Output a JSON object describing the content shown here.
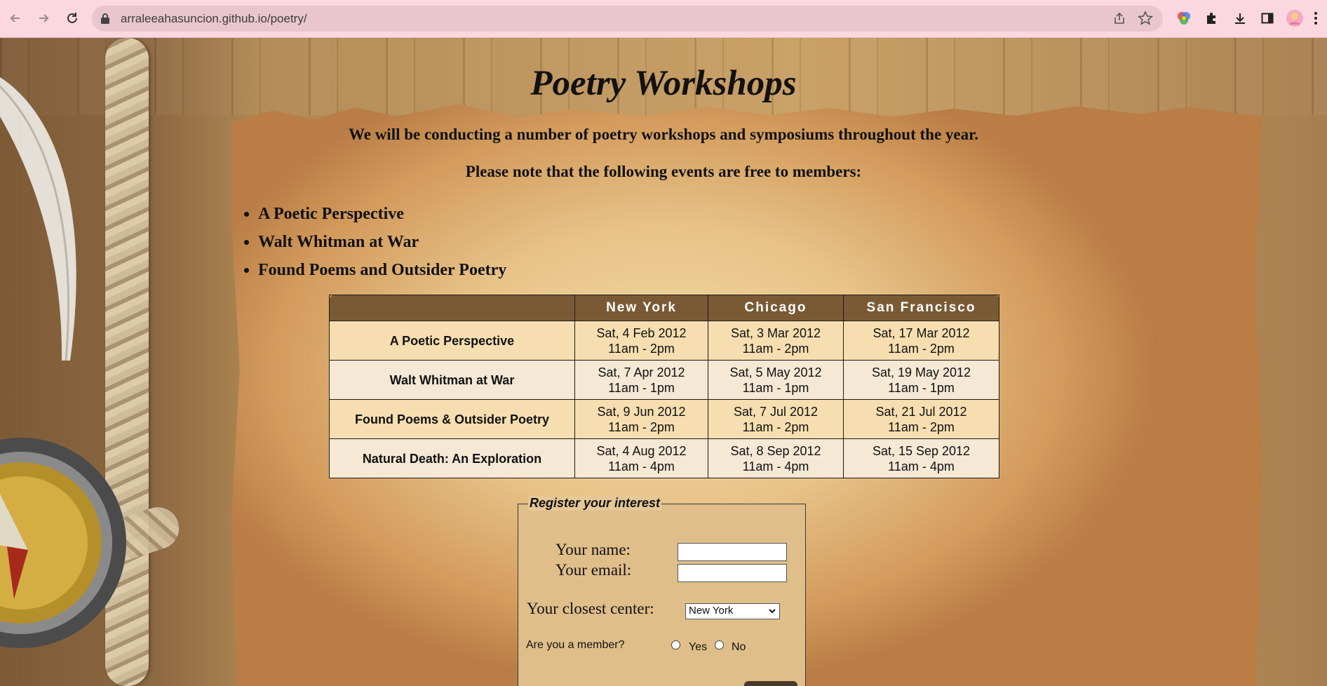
{
  "browser": {
    "url": "arraleeahasuncion.github.io/poetry/",
    "icons": [
      "back-icon",
      "forward-icon",
      "reload-icon",
      "lock-icon",
      "share-icon",
      "star-icon",
      "color-extension-icon",
      "puzzle-extension-icon",
      "download-icon",
      "side-panel-icon",
      "profile-avatar",
      "menu-icon"
    ]
  },
  "page": {
    "title": "Poetry Workshops",
    "intro_1": "We will be conducting a number of poetry workshops and symposiums throughout the year.",
    "intro_2": "Please note that the following events are free to members:",
    "free_events": [
      "A Poetic Perspective",
      "Walt Whitman at War",
      "Found Poems and Outsider Poetry"
    ]
  },
  "schedule": {
    "headers": [
      "",
      "New York",
      "Chicago",
      "San Francisco"
    ],
    "rows": [
      {
        "event": "A Poetic Perspective",
        "ny_date": "Sat, 4 Feb 2012",
        "ny_time": "11am - 2pm",
        "chi_date": "Sat, 3 Mar 2012",
        "chi_time": "11am - 2pm",
        "sf_date": "Sat, 17 Mar 2012",
        "sf_time": "11am - 2pm"
      },
      {
        "event": "Walt Whitman at War",
        "ny_date": "Sat, 7 Apr 2012",
        "ny_time": "11am - 1pm",
        "chi_date": "Sat, 5 May 2012",
        "chi_time": "11am - 1pm",
        "sf_date": "Sat, 19 May 2012",
        "sf_time": "11am - 1pm"
      },
      {
        "event": "Found Poems & Outsider Poetry",
        "ny_date": "Sat, 9 Jun 2012",
        "ny_time": "11am - 2pm",
        "chi_date": "Sat, 7 Jul 2012",
        "chi_time": "11am - 2pm",
        "sf_date": "Sat, 21 Jul 2012",
        "sf_time": "11am - 2pm"
      },
      {
        "event": "Natural Death: An Exploration",
        "ny_date": "Sat, 4 Aug 2012",
        "ny_time": "11am - 4pm",
        "chi_date": "Sat, 8 Sep 2012",
        "chi_time": "11am - 4pm",
        "sf_date": "Sat, 15 Sep 2012",
        "sf_time": "11am - 4pm"
      }
    ]
  },
  "form": {
    "legend": "Register your interest",
    "name_label": "Your name:",
    "name_value": "",
    "email_label": "Your email:",
    "email_value": "",
    "center_label": "Your closest center:",
    "center_selected": "New York",
    "member_label": "Are you a member?",
    "member_yes": "Yes",
    "member_no": "No"
  },
  "colors": {
    "chrome_bg": "#fbd7e0",
    "table_header": "#7a5a35",
    "row_odd": "#f6deb0",
    "row_even": "#f5e8d4",
    "fieldset_bg": "#dfbe8a"
  }
}
